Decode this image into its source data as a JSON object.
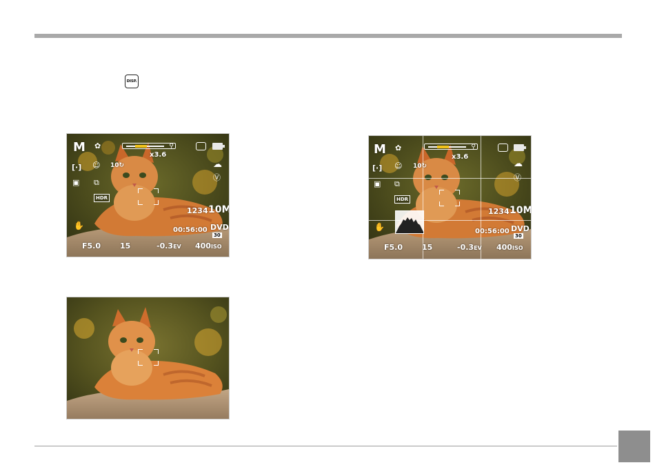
{
  "page": {
    "disp_button_label": "DISP."
  },
  "screen_overlay": {
    "mode": "M",
    "zoom": "x3.6",
    "zoom_level_fraction": 0.3,
    "shot_count": "1234",
    "resolution": "10M",
    "record_time": "00:56:00",
    "video_format": "DVD",
    "video_fps": "30",
    "aperture": "F5.0",
    "shutter": "15",
    "ev": "-0.3",
    "ev_unit": "EV",
    "iso": "400",
    "iso_unit": "ISO",
    "hdr": "HDR",
    "timer": "10",
    "af_area": "[·]"
  },
  "icons": {
    "macro": "macro-flower-icon",
    "face_detect": "face-detection-icon",
    "self_timer": "self-timer-icon",
    "metering": "metering-icon",
    "continuous": "continuous-shot-icon",
    "stabilizer": "hand-stabilizer-icon",
    "weather": "white-balance-cloudy-icon",
    "scene": "scene-mode-icon",
    "memory_card": "memory-card-icon",
    "battery": "battery-icon"
  },
  "colors": {
    "zoom_fill": "#f2c31b",
    "header_bar": "#a9a9a9",
    "page_box": "#8e8e8e"
  }
}
